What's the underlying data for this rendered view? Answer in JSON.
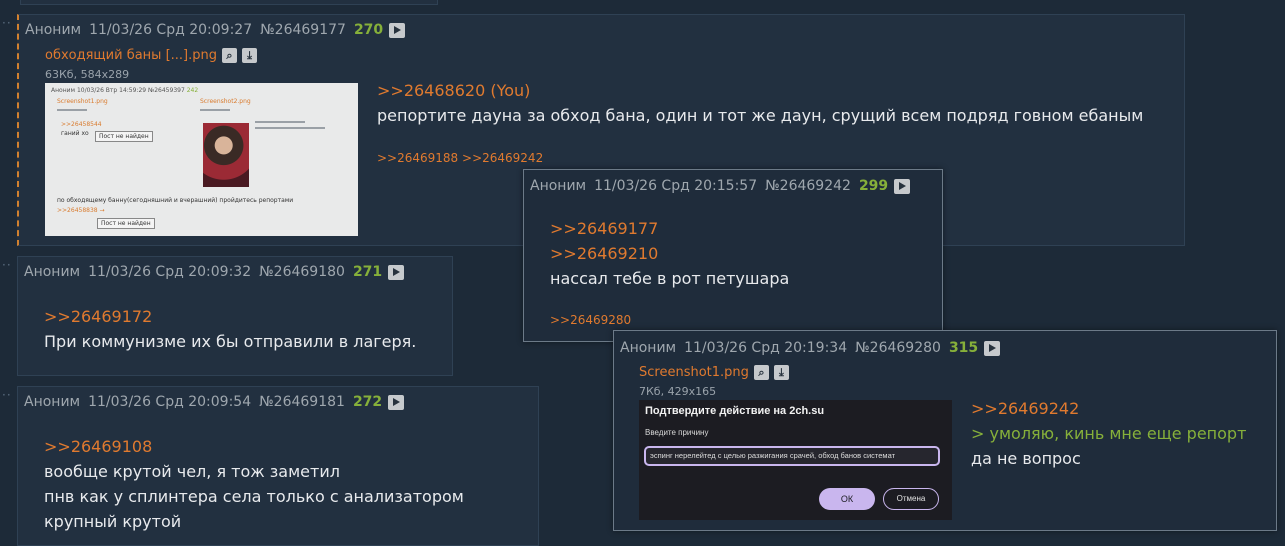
{
  "posts": [
    {
      "name": "Аноним",
      "date": "11/03/26 Срд 20:09:27",
      "num": "№26469177",
      "count": "270",
      "file": {
        "name": "обходящий баны [...].png",
        "meta": "63Кб, 584x289"
      },
      "reply": ">>26468620 (You)",
      "lines": [
        "репортите дауна за обход бана, один и тот же даун, срущий всем подряд говном ебаным"
      ],
      "backrefs": [
        ">>26469188",
        ">>26469242"
      ]
    },
    {
      "name": "Аноним",
      "date": "11/03/26 Срд 20:15:57",
      "num": "№26469242",
      "count": "299",
      "replies": [
        ">>26469177",
        ">>26469210"
      ],
      "lines": [
        "нассал тебе в рот петушара"
      ],
      "backrefs": [
        ">>26469280"
      ]
    },
    {
      "name": "Аноним",
      "date": "11/03/26 Срд 20:09:32",
      "num": "№26469180",
      "count": "271",
      "reply": ">>26469172",
      "lines": [
        "При коммунизме их бы отправили в лагеря."
      ]
    },
    {
      "name": "Аноним",
      "date": "11/03/26 Срд 20:19:34",
      "num": "№26469280",
      "count": "315",
      "file": {
        "name": "Screenshot1.png",
        "meta": "7Кб, 429x165"
      },
      "reply": ">>26469242",
      "quote": "> умоляю, кинь мне еще репорт",
      "lines": [
        "да не вопрос"
      ]
    },
    {
      "name": "Аноним",
      "date": "11/03/26 Срд 20:09:54",
      "num": "№26469181",
      "count": "272",
      "reply": ">>26469108",
      "lines": [
        "вообще крутой чел, я тож заметил",
        "пнв как у сплинтера села только с анализатором",
        "крупный крутой"
      ]
    }
  ],
  "thumb1": {
    "header": "Аноним 10/03/26 Втр 14:59:29 №26459397",
    "num_label": "242",
    "file1": "Screenshot1.png",
    "file2": "Screenshot2.png",
    "link1": ">>26458544",
    "text1": "ганий хо",
    "box1": "Пост не найден",
    "text2": "по обходящему банну(сегодняшний и вчерашний) пройдитесь репортами",
    "link2": ">>26458838 →",
    "box2": "Пост не найден"
  },
  "thumb2": {
    "title": "Подтвердите действие на 2ch.su",
    "label": "Введите причину",
    "field_value": "эспинг нерелейтед с целью разжигания срачей, обход банов системат",
    "ok": "ОК",
    "cancel": "Отмена"
  },
  "icons": [
    "play-icon",
    "search-icon",
    "download-icon"
  ],
  "colors": {
    "bg": "#1d2a38",
    "post": "#223040",
    "link": "#e07a2f",
    "count": "#86b03a",
    "quote": "#86b03a"
  }
}
